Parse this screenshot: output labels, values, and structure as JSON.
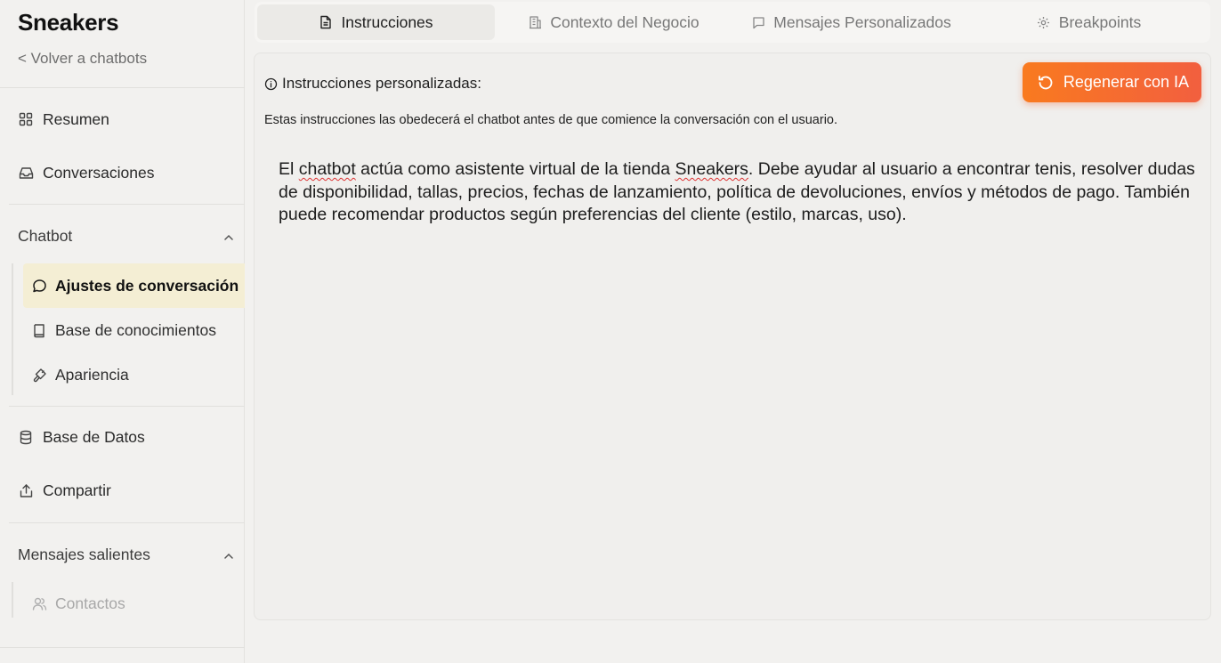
{
  "sidebar": {
    "title": "Sneakers",
    "back_link": "< Volver a chatbots",
    "items": {
      "resumen": {
        "label": "Resumen",
        "icon": "grid-icon"
      },
      "conversaciones": {
        "label": "Conversaciones",
        "icon": "inbox-icon"
      }
    },
    "chatbot_section": {
      "label": "Chatbot",
      "items": [
        {
          "label": "Ajustes de conversación",
          "icon": "chat-bubble-icon",
          "active": true
        },
        {
          "label": "Base de conocimientos",
          "icon": "book-icon"
        },
        {
          "label": "Apariencia",
          "icon": "paintbrush-icon"
        }
      ]
    },
    "more_items": {
      "base_datos": {
        "label": "Base de Datos",
        "icon": "database-icon"
      },
      "compartir": {
        "label": "Compartir",
        "icon": "share-icon"
      }
    },
    "outgoing_section": {
      "label": "Mensajes salientes",
      "items": [
        {
          "label": "Contactos",
          "icon": "users-icon"
        }
      ]
    }
  },
  "tabs": [
    {
      "label": "Instrucciones",
      "icon": "document-icon",
      "active": true
    },
    {
      "label": "Contexto del Negocio",
      "icon": "building-icon"
    },
    {
      "label": "Mensajes Personalizados",
      "icon": "message-square-icon"
    },
    {
      "label": "Breakpoints",
      "icon": "gear-icon"
    }
  ],
  "panel": {
    "label": "Instrucciones personalizadas:",
    "description": "Estas instrucciones las obedecerá el chatbot antes de que comience la conversación con el usuario.",
    "regenerate_button": "Regenerar con IA",
    "instructions_parts": {
      "p1": "El ",
      "w1": "chatbot",
      "p2": " actúa como asistente virtual de la tienda ",
      "w2": "Sneakers",
      "p3": ". Debe ayudar al usuario a encontrar tenis, resolver dudas de disponibilidad, tallas, precios, fechas de lanzamiento, política de devoluciones, envíos y métodos de pago. También puede recomendar productos según preferencias del cliente (estilo, marcas, uso)."
    }
  },
  "colors": {
    "accent_start": "#f97a1f",
    "accent_end": "#f25f3f",
    "active_nav_bg": "#f4eed4",
    "background": "#f2f1ef"
  }
}
